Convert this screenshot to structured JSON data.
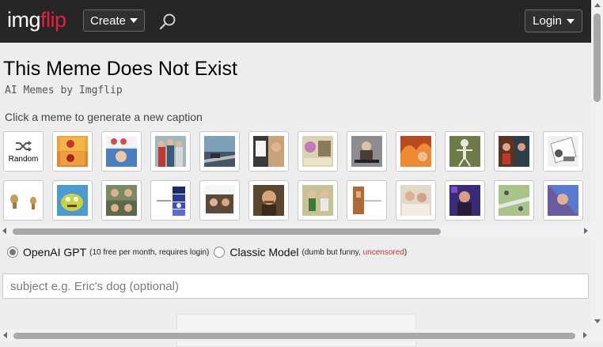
{
  "header": {
    "logo_part1": "img",
    "logo_part2": "flip",
    "create_label": "Create",
    "login_label": "Login",
    "search_icon": "search-icon"
  },
  "page": {
    "title": "This Meme Does Not Exist",
    "subtitle": "AI Memes by Imgflip",
    "instruction": "Click a meme to generate a new caption"
  },
  "grid": {
    "random_label": "Random"
  },
  "models": {
    "openai_name": "OpenAI GPT",
    "openai_note": "(10 free per month, requires login)",
    "classic_name": "Classic Model",
    "classic_note_pre": "(dumb but funny, ",
    "classic_note_red": "uncensored",
    "classic_note_post": ")",
    "selected": "OpenAI GPT"
  },
  "subject": {
    "placeholder": "subject e.g. Eric's dog (optional)",
    "value": ""
  },
  "colors": {
    "topbar": "#262626",
    "brand_red": "#e0233a",
    "accent_red": "#d32f2f"
  }
}
